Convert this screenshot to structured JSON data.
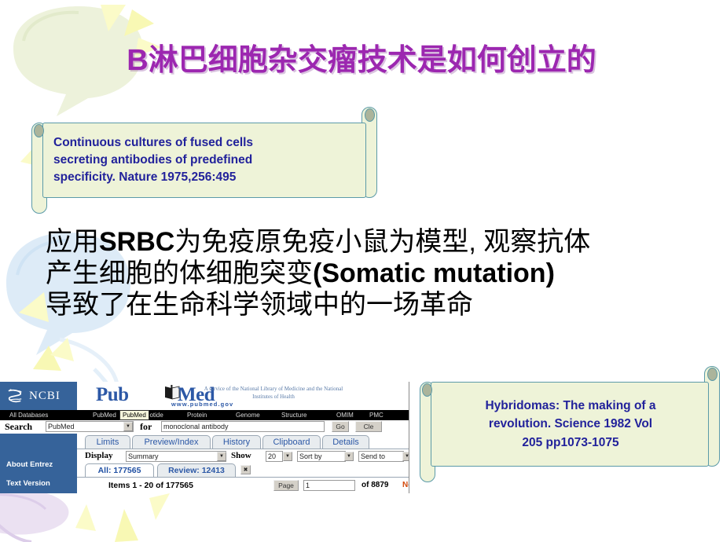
{
  "slide": {
    "title": "B淋巴细胞杂交瘤技术是如何创立的",
    "title_color": "#9C27B0",
    "background_color": "#FFFFFF"
  },
  "callout_nature": {
    "lines": [
      "Continuous cultures of fused  cells",
      "secreting antibodies of predefined",
      "specificity. Nature 1975,256:495"
    ],
    "text_color": "#22229B",
    "fill_color": "#EEF3D8",
    "border_color": "#5B9AA8"
  },
  "callout_science": {
    "lines": [
      "Hybridomas: The making of a",
      "revolution. Science 1982 Vol",
      "205 pp1073-1075"
    ],
    "text_color": "#22229B",
    "fill_color": "#EEF3D8",
    "border_color": "#5B9AA8"
  },
  "body": {
    "line1_a": "应用",
    "line1_b": "SRBC",
    "line1_c": "为免疫原免疫小鼠为模型, 观察抗体",
    "line2_a": "产生细胞的体细胞突变",
    "line2_b": "(Somatic mutation)",
    "line3": "导致了在生命科学领域中的一场革命",
    "text_color": "#000000"
  },
  "pubmed": {
    "sidebar": {
      "brand": "NCBI",
      "logo_icon": "dna-helix-icon",
      "links": [
        "About Entrez",
        "Text Version"
      ],
      "background_color": "#36639A"
    },
    "logo": {
      "pub": "Pub",
      "med": "Med",
      "book_icon": "open-book-icon",
      "url": "www.pubmed.gov",
      "tagline": "A service of the National Library of Medicine and the National Institutes of Health",
      "color": "#2C58A6"
    },
    "navbar": {
      "items": [
        "All Databases",
        "PubMed",
        "Nucleotide",
        "Protein",
        "Genome",
        "Structure",
        "OMIM",
        "PMC"
      ],
      "tooltip": "PubMed",
      "background_color": "#000000"
    },
    "search": {
      "label": "Search",
      "database_value": "PubMed",
      "for_label": "for",
      "query_value": "monoclonal antibody",
      "go_label": "Go",
      "clear_label": "Cle",
      "dropdown_icon": "chevron-down-icon"
    },
    "tabs": [
      "Limits",
      "Preview/Index",
      "History",
      "Clipboard",
      "Details"
    ],
    "display_row": {
      "display_label": "Display",
      "display_value": "Summary",
      "show_label": "Show",
      "show_value": "20",
      "sort_value": "Sort by",
      "send_value": "Send to"
    },
    "count_tabs": [
      {
        "label": "All: 177565",
        "active": true
      },
      {
        "label": "Review: 12413",
        "active": false
      }
    ],
    "close_tab_icon": "close-x-icon",
    "items_row": {
      "items_text": "Items 1 - 20 of 177565",
      "page_label": "Page",
      "page_value": "1",
      "of_text": "of 8879",
      "next_label": "Next",
      "next_color": "#D2490C"
    }
  },
  "decor": {
    "green_bubble_color": "#EDF2DB",
    "blue_bubble_color": "#DDEBF7",
    "lavender_bubble_color": "#E4D7EE",
    "ray_color": "#FBFBC8",
    "ray_color_strong": "#F7F7A8"
  }
}
